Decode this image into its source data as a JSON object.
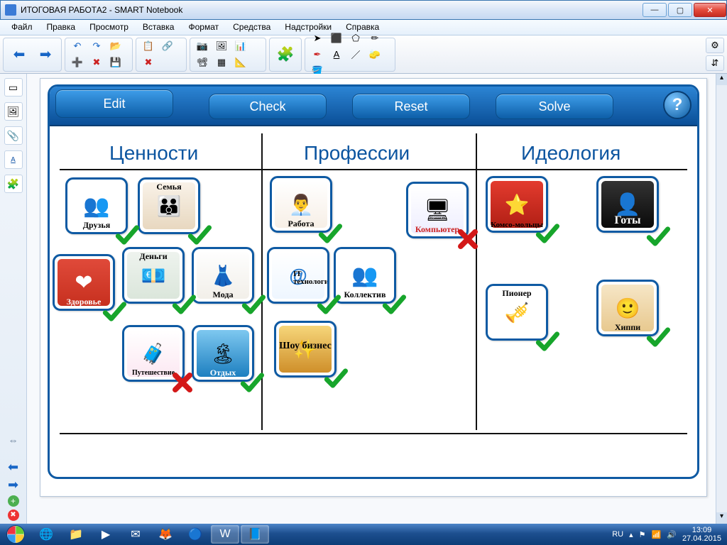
{
  "window": {
    "title": "ИТОГОВАЯ РАБОТА2 - SMART Notebook"
  },
  "menu": {
    "items": [
      "Файл",
      "Правка",
      "Просмотр",
      "Вставка",
      "Формат",
      "Средства",
      "Надстройки",
      "Справка"
    ]
  },
  "activity": {
    "buttons": {
      "edit": "Edit",
      "check": "Check",
      "reset": "Reset",
      "solve": "Solve",
      "help": "?"
    },
    "columns": {
      "c1": "Ценности",
      "c2": "Профессии",
      "c3": "Идеология"
    },
    "cards": {
      "friends": {
        "label": "Друзья",
        "label_pos": "bottom",
        "bg": "linear-gradient(#fff,#fff)",
        "deco": "👥"
      },
      "family": {
        "label": "Семья",
        "label_pos": "top",
        "bg": "linear-gradient(#f9f2e8,#e8d8c0)",
        "deco": "👨‍👩‍👧"
      },
      "health": {
        "label": "Здоровье",
        "label_pos": "bottom",
        "bg": "linear-gradient(#e04a3a,#c7301f)",
        "deco": "❤"
      },
      "money": {
        "label": "Деньги",
        "label_pos": "top",
        "bg": "linear-gradient(#eef3ee,#dbe6db)",
        "deco": "💶"
      },
      "fashion": {
        "label": "Мода",
        "label_pos": "bottom",
        "bg": "linear-gradient(#fefefe,#f2efe9)",
        "deco": "👗"
      },
      "travel": {
        "label": "Путешествие",
        "label_pos": "bottom",
        "bg": "linear-gradient(#fff,#fce)",
        "deco": "🧳"
      },
      "rest": {
        "label": "Отдых",
        "label_pos": "bottom",
        "bg": "linear-gradient(#7ec8f0,#1d7fc0)",
        "deco": "🏝"
      },
      "work": {
        "label": "Работа",
        "label_pos": "bottom",
        "bg": "linear-gradient(#fff,#f7efe6)",
        "deco": "👨‍💼"
      },
      "it": {
        "label": "IT технологии",
        "label_pos": "middle",
        "bg": "linear-gradient(#fff,#eef6ff)",
        "deco": "@"
      },
      "team": {
        "label": "Коллектив",
        "label_pos": "bottom",
        "bg": "linear-gradient(#fff,#fff)",
        "deco": "👥"
      },
      "show": {
        "label": "Шоу бизнес",
        "label_pos": "middle",
        "bg": "linear-gradient(#f6d67a,#cf8f2a)",
        "deco": "✨"
      },
      "computer": {
        "label": "Компьютер",
        "label_pos": "bottom",
        "bg": "linear-gradient(#fff,#eef)",
        "deco": "🖥"
      },
      "komsomol": {
        "label": "Комсо-мольцы",
        "label_pos": "bottom",
        "bg": "linear-gradient(#e33b2e,#b11f15)",
        "deco": "⭐"
      },
      "goths": {
        "label": "Готы",
        "label_pos": "bottom",
        "bg": "linear-gradient(#333,#0a0a0a)",
        "deco": "👤"
      },
      "pioneer": {
        "label": "Пионер",
        "label_pos": "top",
        "bg": "linear-gradient(#fff,#fff)",
        "deco": "🎺"
      },
      "hippie": {
        "label": "Хиппи",
        "label_pos": "bottom",
        "bg": "linear-gradient(#f6e6c6,#e8c98f)",
        "deco": "🙂"
      }
    },
    "marks": {
      "friends": "check",
      "family": "check",
      "health": "check",
      "money": "check",
      "fashion": "check",
      "travel": "cross",
      "rest": "check",
      "work": "check",
      "it": "check",
      "team": "check",
      "show": "check",
      "computer": "cross",
      "komsomol": "check",
      "goths": "check",
      "pioneer": "check",
      "hippie": "check"
    }
  },
  "tray": {
    "lang": "RU",
    "time": "13:09",
    "date": "27.04.2015"
  }
}
